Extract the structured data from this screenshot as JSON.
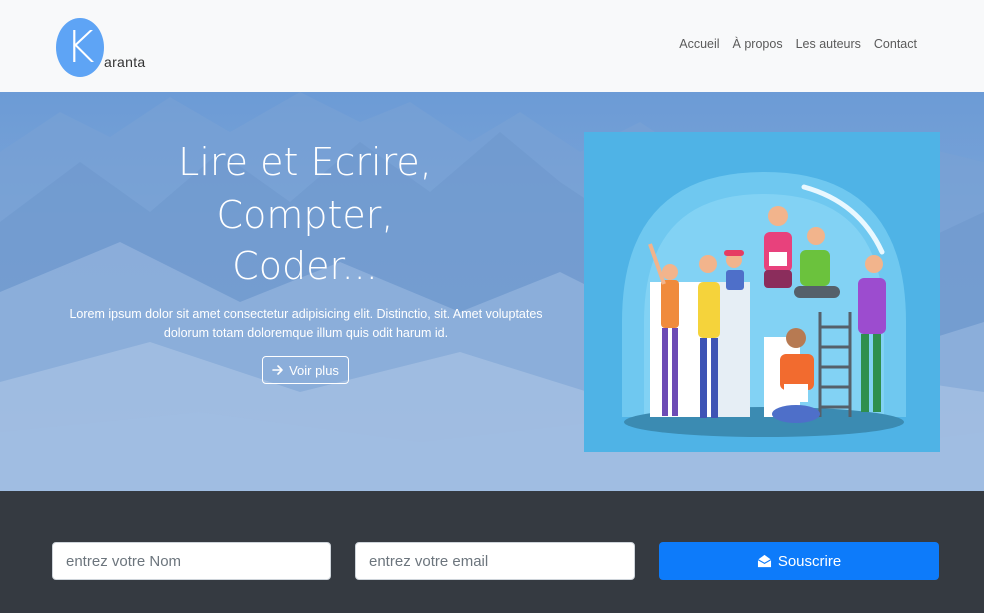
{
  "brand": {
    "initial": "K",
    "rest": "aranta"
  },
  "nav": {
    "items": [
      "Accueil",
      "À propos",
      "Les auteurs",
      "Contact"
    ]
  },
  "hero": {
    "title_lines": [
      "Lire et Ecrire,",
      "Compter,",
      "Coder..."
    ],
    "text": "Lorem ipsum dolor sit amet consectetur adipisicing elit. Distinctio, sit. Amet voluptates dolorum totam doloremque illum quis odit harum id.",
    "button": {
      "label": "Voir plus",
      "icon": "arrow-right-icon"
    }
  },
  "subscribe": {
    "name_placeholder": "entrez votre Nom",
    "email_placeholder": "entrez votre email",
    "button": {
      "label": "Souscrire",
      "icon": "envelope-open-icon"
    }
  },
  "colors": {
    "accent": "#0d7bfa",
    "logo": "#5ea4f5",
    "footer": "#353a41",
    "navbar": "#f8f9fa"
  }
}
